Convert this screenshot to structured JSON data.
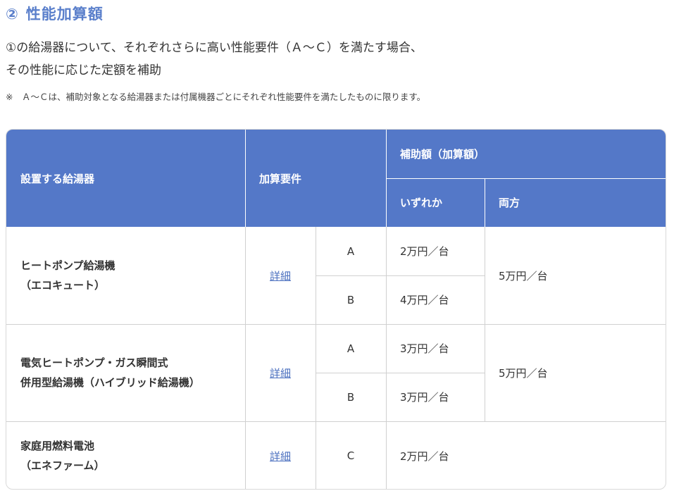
{
  "heading": {
    "number": "②",
    "title": "性能加算額"
  },
  "intro": {
    "line1": "①の給湯器について、それぞれさらに高い性能要件（Ａ～Ｃ）を満たす場合、",
    "line2": "その性能に応じた定額を補助"
  },
  "note": "※　Ａ～Ｃは、補助対象となる給湯器または付属機器ごとにそれぞれ性能要件を満たしたものに限ります。",
  "table": {
    "headers": {
      "device": "設置する給湯器",
      "requirement": "加算要件",
      "amount": "補助額（加算額）",
      "either": "いずれか",
      "both": "両方"
    },
    "rows": [
      {
        "name_line1": "ヒートポンプ給湯機",
        "name_line2": "（エコキュート）",
        "link": "詳細",
        "sub": [
          {
            "req": "A",
            "either": "2万円／台"
          },
          {
            "req": "B",
            "either": "4万円／台"
          }
        ],
        "both": "5万円／台"
      },
      {
        "name_line1": "電気ヒートポンプ・ガス瞬間式",
        "name_line2": "併用型給湯機（ハイブリッド給湯機）",
        "link": "詳細",
        "sub": [
          {
            "req": "A",
            "either": "3万円／台"
          },
          {
            "req": "B",
            "either": "3万円／台"
          }
        ],
        "both": "5万円／台"
      },
      {
        "name_line1": "家庭用燃料電池",
        "name_line2": "（エネファーム）",
        "link": "詳細",
        "sub": [
          {
            "req": "C",
            "either": "2万円／台"
          }
        ]
      }
    ]
  }
}
